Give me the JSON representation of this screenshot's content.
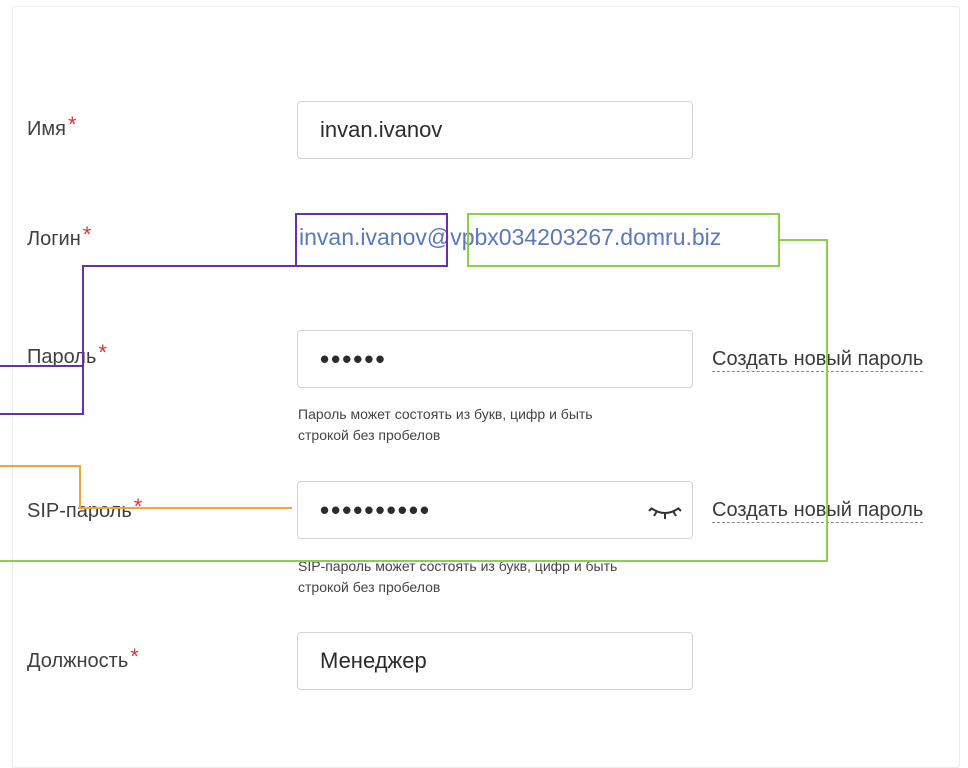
{
  "form": {
    "name": {
      "label": "Имя",
      "value": "invan.ivanov"
    },
    "login": {
      "label": "Логин",
      "value": "invan.ivanov@vpbx034203267.domru.biz"
    },
    "password": {
      "label": "Пароль",
      "value": "••••••",
      "generate_link": "Создать новый пароль",
      "hint_line1": "Пароль может состоять из букв, цифр и быть",
      "hint_line2": "строкой без пробелов"
    },
    "sip_password": {
      "label": "SIP-пароль",
      "value": "••••••••••",
      "generate_link": "Создать новый пароль",
      "hint_line1": "SIP-пароль может состоять из букв, цифр и быть",
      "hint_line2": "строкой без пробелов"
    },
    "position": {
      "label": "Должность",
      "value": "Менеджер"
    },
    "required_mark": "*"
  },
  "colors": {
    "required": "#e0323c",
    "login_link": "#5a78bb",
    "annotation_purple": "#6a2ea8",
    "annotation_green": "#8cd04a",
    "annotation_orange": "#f0a63a"
  },
  "icons": {
    "sip_toggle": "eye-closed-icon"
  }
}
